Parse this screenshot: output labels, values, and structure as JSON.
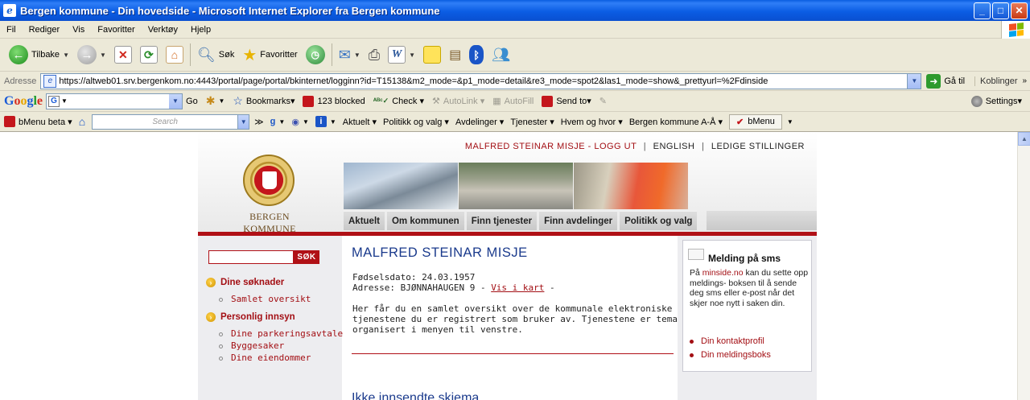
{
  "window": {
    "title": "Bergen kommune - Din hovedside - Microsoft Internet Explorer fra Bergen kommune",
    "minimize": "_",
    "maximize": "□",
    "close": "✕"
  },
  "menu": [
    "Fil",
    "Rediger",
    "Vis",
    "Favoritter",
    "Verktøy",
    "Hjelp"
  ],
  "toolbar": {
    "back_label": "Tilbake",
    "search_label": "Søk",
    "favorites_label": "Favoritter"
  },
  "address": {
    "label": "Adresse",
    "url": "https://altweb01.srv.bergenkom.no:4443/portal/page/portal/bkinternet/logginn?id=T15138&m2_mode=&p1_mode=detail&re3_mode=spot2&las1_mode=show&_prettyurl=%2Fdinside",
    "go_label": "Gå til",
    "links_label": "Koblinger"
  },
  "google_toolbar": {
    "go_label": "Go",
    "bookmarks": "Bookmarks▾",
    "blocked": "123 blocked",
    "check": "Check ▾",
    "autolink": "AutoLink ▾",
    "autofill": "AutoFill",
    "send_to": "Send to▾",
    "settings": "Settings▾"
  },
  "bmenu_toolbar": {
    "bmenu_beta": "bMenu beta ▾",
    "search_placeholder": "Search",
    "items": [
      "Aktuelt ▾",
      "Politikk og valg ▾",
      "Avdelinger ▾",
      "Tjenester ▾",
      "Hvem og hvor ▾",
      "Bergen kommune A-Å ▾"
    ],
    "bmenu_button": "bMenu"
  },
  "site": {
    "top_links": {
      "user_logout": "MALFRED STEINAR MISJE - LOGG UT",
      "english": "ENGLISH",
      "jobs": "LEDIGE STILLINGER",
      "sep": "|"
    },
    "brand": "BERGEN KOMMUNE",
    "nav": [
      "Aktuelt",
      "Om kommunen",
      "Finn tjenester",
      "Finn avdelinger",
      "Politikk og valg"
    ],
    "search_button": "SØK",
    "sidebar": {
      "section1": "Dine søknader",
      "section1_links": [
        "Samlet oversikt"
      ],
      "section2": "Personlig innsyn",
      "section2_links": [
        "Dine parkeringsavtaler",
        "Byggesaker",
        "Dine eiendommer"
      ]
    },
    "main": {
      "name": "MALFRED STEINAR MISJE",
      "birth_line": "Fødselsdato: 24.03.1957",
      "address_prefix": "Adresse: BJØNNAHAUGEN 9 - ",
      "map_link": "Vis i kart",
      "address_suffix": " -",
      "intro_lines": [
        "Her får du en samlet oversikt over de kommunale elektroniske",
        "tjenestene du er registrert som bruker av. Tjenestene er tematisk",
        "organisert i menyen til venstre."
      ],
      "subheading": "Ikke innsendte skjema"
    },
    "sms_box": {
      "title": "Melding på sms",
      "text_prefix": "På ",
      "text_link": "minside.no",
      "text_rest": " kan du sette opp meldings- boksen til å sende deg sms eller e-post når det skjer noe nytt i saken din.",
      "links": [
        "Din kontaktprofil",
        "Din meldingsboks"
      ]
    }
  }
}
